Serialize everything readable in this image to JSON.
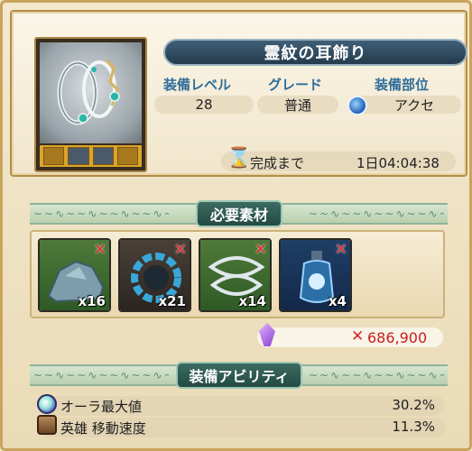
{
  "item": {
    "name": "霊紋の耳飾り",
    "thumbnail_icon": "earring-icon",
    "slot_icons": [
      "empty-slot",
      "rune-slot",
      "rune-slot",
      "empty-slot"
    ]
  },
  "stats": [
    {
      "label": "装備レベル",
      "value": "28"
    },
    {
      "label": "グレード",
      "value": "普通"
    },
    {
      "label": "装備部位",
      "value": "アクセ",
      "icon": "accessory-swirl-icon"
    }
  ],
  "timer": {
    "label": "完成まで",
    "value": "1日04:04:38",
    "icon": "hourglass-icon"
  },
  "materials": {
    "title": "必要素材",
    "items": [
      {
        "icon": "ore-rock-icon",
        "quantity": "x16",
        "missing_mark": "✕"
      },
      {
        "icon": "shard-ring-icon",
        "quantity": "x21",
        "missing_mark": "✕"
      },
      {
        "icon": "silver-coil-icon",
        "quantity": "x14",
        "missing_mark": "✕"
      },
      {
        "icon": "blue-vial-icon",
        "quantity": "x4",
        "missing_mark": "✕"
      }
    ],
    "cost_icon": "purple-crystal-icon",
    "cost_mark": "✕",
    "cost_value": "686,900"
  },
  "abilities": {
    "title": "装備アビリティ",
    "items": [
      {
        "icon": "aura-orb-icon",
        "label": "オーラ最大値",
        "value": "30.2%"
      },
      {
        "icon": "hero-boot-icon",
        "label": "英雄 移動速度",
        "value": "11.3%"
      }
    ]
  },
  "colors": {
    "title_bar": "#2b4558",
    "stat_label": "#2e6d99",
    "cost_red": "#c81e1e",
    "section_green": "#234a43"
  }
}
